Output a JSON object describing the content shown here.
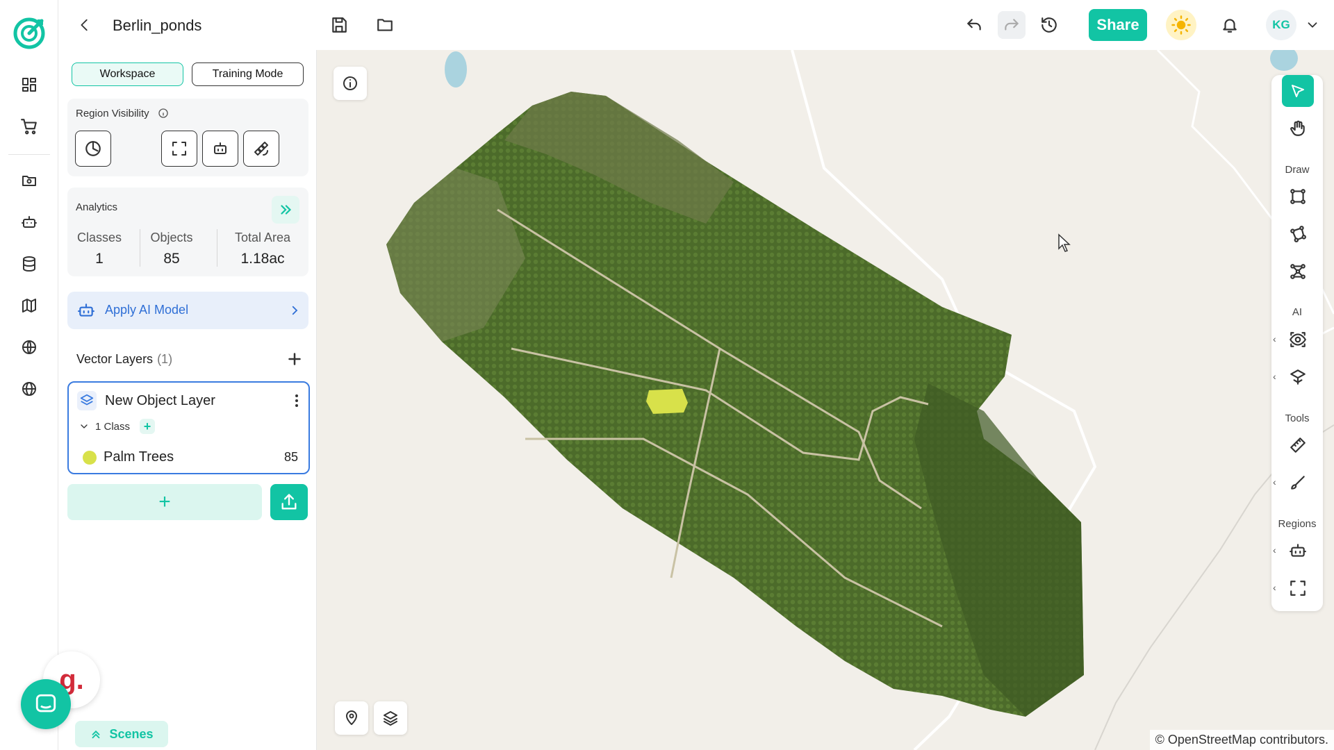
{
  "app": {
    "title": "Berlin_ponds"
  },
  "topbar": {
    "share_label": "Share",
    "avatar_initials": "KG"
  },
  "panel": {
    "workspace_label": "Workspace",
    "training_mode_label": "Training Mode",
    "region_visibility_title": "Region Visibility",
    "analytics": {
      "title": "Analytics",
      "classes_label": "Classes",
      "classes_value": "1",
      "objects_label": "Objects",
      "objects_value": "85",
      "area_label": "Total Area",
      "area_value": "1.18ac"
    },
    "apply_ai_label": "Apply AI Model",
    "vector_layers": {
      "title": "Vector Layers",
      "count": "(1)"
    },
    "layer": {
      "name": "New Object Layer",
      "class_count_label": "1 Class",
      "classes": [
        {
          "name": "Palm Trees",
          "count": "85",
          "color": "#d8e14a"
        }
      ]
    },
    "scenes_label": "Scenes"
  },
  "map": {
    "attribution": "© OpenStreetMap contributors."
  },
  "right_toolbar": {
    "sections": [
      "Draw",
      "AI",
      "Tools",
      "Regions"
    ]
  },
  "colors": {
    "accent": "#12c4a4",
    "ai_blue": "#2f6fd6",
    "layer_border": "#3a7be0",
    "class_color": "#d8e14a"
  }
}
